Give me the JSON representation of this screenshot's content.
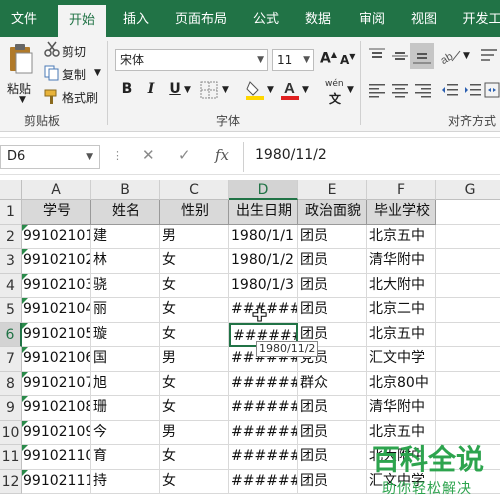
{
  "tabs": [
    "文件",
    "开始",
    "插入",
    "页面布局",
    "公式",
    "数据",
    "审阅",
    "视图",
    "开发工"
  ],
  "active_tab": "开始",
  "clipboard": {
    "paste": "粘贴",
    "cut": "剪切",
    "copy": "复制",
    "painter": "格式刷",
    "group_label": "剪贴板"
  },
  "font": {
    "name": "宋体",
    "size": "11",
    "bold": "B",
    "italic": "I",
    "underline": "U",
    "font_color": "#e02020",
    "fill_color": "#ffd700",
    "wen": "wén",
    "group_label": "字体"
  },
  "align": {
    "group_label": "对齐方式"
  },
  "formula_bar": {
    "name_box": "D6",
    "formula": "1980/11/2"
  },
  "columns": [
    "A",
    "B",
    "C",
    "D",
    "E",
    "F",
    "G"
  ],
  "selected_column": "D",
  "header_row": [
    "学号",
    "姓名",
    "性别",
    "出生日期",
    "政治面貌",
    "毕业学校"
  ],
  "rows": [
    {
      "num": "2",
      "cells": [
        "99102101",
        "建",
        "男",
        "1980/1/1",
        "团员",
        "北京五中"
      ]
    },
    {
      "num": "3",
      "cells": [
        "99102102",
        "林",
        "女",
        "1980/1/2",
        "团员",
        "清华附中"
      ]
    },
    {
      "num": "4",
      "cells": [
        "99102103",
        "骁",
        "女",
        "1980/1/3",
        "团员",
        "北大附中"
      ]
    },
    {
      "num": "5",
      "cells": [
        "99102104",
        "丽",
        "女",
        "########",
        "团员",
        "北京二中"
      ]
    },
    {
      "num": "6",
      "cells": [
        "99102105",
        "璇",
        "女",
        "########",
        "团员",
        "北京五中"
      ]
    },
    {
      "num": "7",
      "cells": [
        "99102106",
        "国",
        "男",
        "########",
        "党员",
        "汇文中学"
      ]
    },
    {
      "num": "8",
      "cells": [
        "99102107",
        "旭",
        "女",
        "########",
        "群众",
        "北京80中"
      ]
    },
    {
      "num": "9",
      "cells": [
        "99102108",
        "珊",
        "女",
        "########",
        "团员",
        "清华附中"
      ]
    },
    {
      "num": "10",
      "cells": [
        "99102109",
        "今",
        "男",
        "########",
        "团员",
        "北京五中"
      ]
    },
    {
      "num": "11",
      "cells": [
        "99102110",
        "育",
        "女",
        "########",
        "团员",
        "北大附中"
      ]
    },
    {
      "num": "12",
      "cells": [
        "99102111",
        "持",
        "女",
        "########",
        "团员",
        "汇文中学"
      ]
    }
  ],
  "header_row_num": "1",
  "selected_row": "6",
  "tooltip": "1980/11/2",
  "watermark": {
    "title": "百科全说",
    "subtitle": "助你轻松解决"
  }
}
